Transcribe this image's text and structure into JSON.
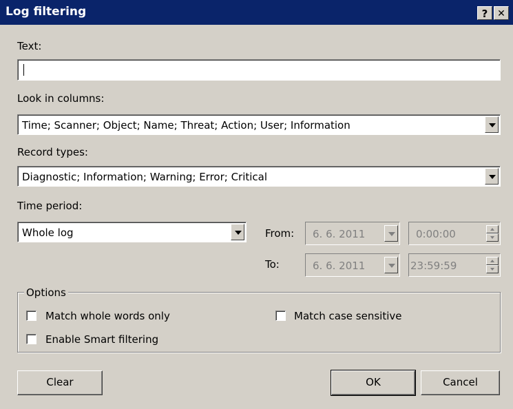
{
  "window": {
    "title": "Log filtering",
    "help_glyph": "?",
    "close_glyph": "✕"
  },
  "text_field": {
    "label": "Text:",
    "value": ""
  },
  "columns": {
    "label": "Look in columns:",
    "value": "Time; Scanner; Object; Name; Threat; Action; User; Information"
  },
  "record_types": {
    "label": "Record types:",
    "value": "Diagnostic; Information; Warning; Error; Critical"
  },
  "time_period": {
    "label": "Time period:",
    "value": "Whole log",
    "from_label": "From:",
    "to_label": "To:",
    "from_date": "6.  6. 2011",
    "from_time": "0:00:00",
    "to_date": "6.  6. 2011",
    "to_time": "23:59:59"
  },
  "options": {
    "title": "Options",
    "match_whole_words": "Match whole words only",
    "match_case": "Match case sensitive",
    "smart_filtering": "Enable Smart filtering"
  },
  "buttons": {
    "clear": "Clear",
    "ok": "OK",
    "cancel": "Cancel"
  },
  "colors": {
    "title_bar": "#0a246a",
    "dialog_bg": "#d4d0c8"
  }
}
